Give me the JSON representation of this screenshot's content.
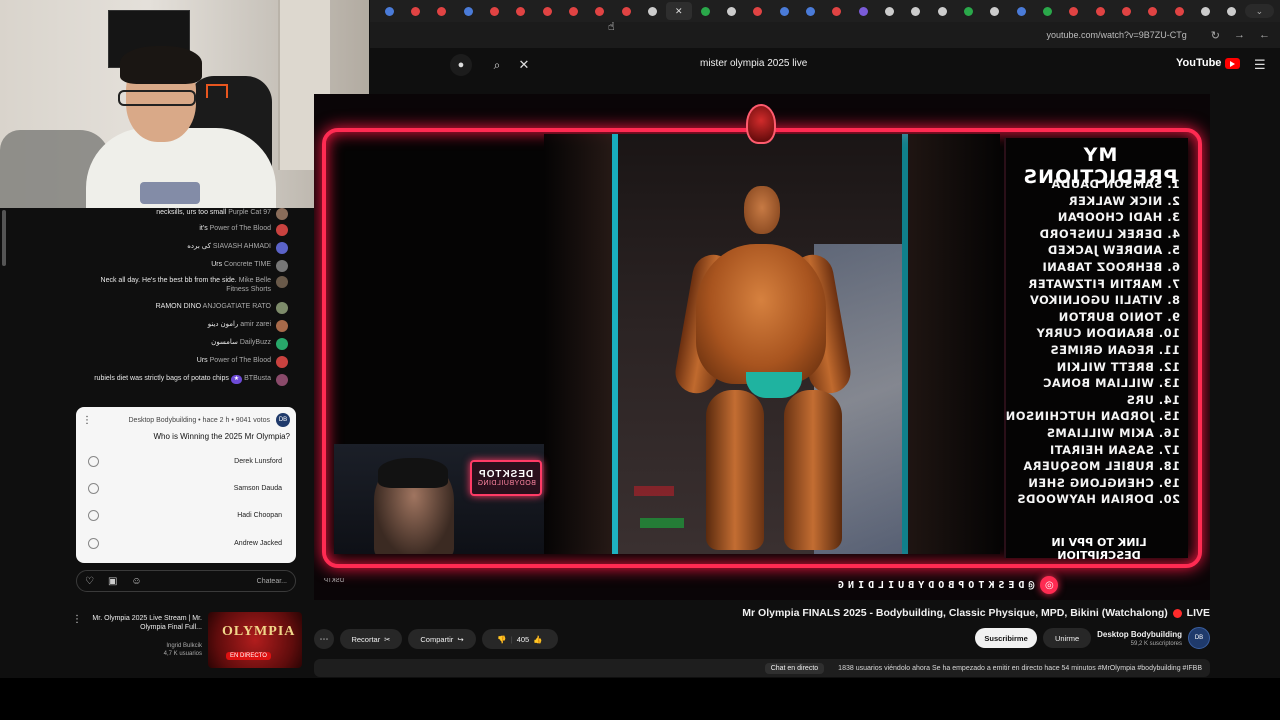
{
  "browser": {
    "tab_count_icons": [
      "i",
      "o",
      "o",
      "o",
      "o",
      "o",
      "o",
      "o",
      "o",
      "o",
      "o",
      "x",
      "o",
      "o",
      "o",
      "o",
      "o",
      "o",
      "o",
      "o",
      "o",
      "o",
      "o",
      "o",
      "o",
      "o",
      "o",
      "o",
      "o",
      "o",
      "o",
      "o",
      "o"
    ],
    "url": "youtube.com/watch?v=9B7ZU-CTg"
  },
  "youtube": {
    "search_query": "mister olympia 2025 live",
    "logo_text": "YouTube"
  },
  "chat": {
    "messages": [
      {
        "author": "Purple Cat 97",
        "text": "necksills, urs too small"
      },
      {
        "author": "Power of The Blood",
        "text": "it's"
      },
      {
        "author": "SIAVASH AHMADI",
        "text": "کی برده"
      },
      {
        "author": "Concrete TIME",
        "text": "Urs"
      },
      {
        "author": "Mike Belle Fitness Shorts",
        "text": "Neck all day. He's the best bb from the side."
      },
      {
        "author": "ANJOGATIATE RATO",
        "text": "RAMON DINO"
      },
      {
        "author": "amir zarei",
        "text": "رامون دینو"
      },
      {
        "author": "DailyBuzz",
        "text": "سامسون"
      },
      {
        "author": "Power of The Blood",
        "text": "Urs"
      },
      {
        "author": "BTBusta",
        "text": "rubiels diet was strictly bags of potato chips",
        "badge": "★"
      }
    ],
    "poll": {
      "meta": "Desktop Bodybuilding • hace 2 h • 9041 votos",
      "question": "Who is Winning the 2025 Mr Olympia?",
      "options": [
        "Derek Lunsford",
        "Samson Dauda",
        "Hadi Choopan",
        "Andrew Jacked"
      ]
    },
    "input_placeholder": "Chatear..."
  },
  "related": {
    "title": "Mr. Olympia 2025 Live Stream | Mr. Olympia Final Full...",
    "channel": "Ingrid Bulkcik",
    "views": "4,7 K usuarios",
    "thumb_text": "OLYMPIA",
    "thumb_live": "EN DIRECTO"
  },
  "player": {
    "predictions_title": "MY PREDICTIONS",
    "predictions": [
      "1. SAMSON DAUDA",
      "2. NICK WALKER",
      "3. HADI CHOOPAN",
      "4. DEREK LUNSFORD",
      "5. ANDREW JACKED",
      "6. BEHROOZ TABANI",
      "7. MARTIN FITZWATER",
      "8. VITALII UGOLNIKOV",
      "9. TONIO BURTON",
      "10. BRANDON CURRY",
      "11. REGAN GRIMES",
      "12. BRETT WILKIN",
      "13. WILLIAM BONAC",
      "14. URS",
      "15. JORDAN HUTCHINSON",
      "16. AKIM WILLIAMS",
      "17. SASAN HEIRATI",
      "18. RUBIEL MOSQUERA",
      "19. CHENGLONG SHEN",
      "20. DORIAN HAYWOODS"
    ],
    "footer": "LINK TO PPV IN DESCRIPTION",
    "badge_line1": "DESKTOP",
    "badge_line2": "BODYBUILDING",
    "handle": "@DESKTOPBODYBUILDING",
    "corner_tag": "DSKTP"
  },
  "video": {
    "title_prefix": "LIVE",
    "title": "Mr Olympia FINALS 2025 - Bodybuilding, Classic Physique, MPD, Bikini (Watchalong)",
    "channel_name": "Desktop Bodybuilding",
    "channel_subs": "59,2 K suscriptores",
    "join_label": "Unirme",
    "subscribe_label": "Suscribirme",
    "likes": "405",
    "share_label": "Compartir",
    "clip_label": "Recortar",
    "description_summary": "1838 usuarios viéndolo ahora  Se ha empezado a emitir en directo hace 54 minutos  #MrOlympia #bodybuilding #IFBB",
    "chip_label": "Chat en directo"
  }
}
